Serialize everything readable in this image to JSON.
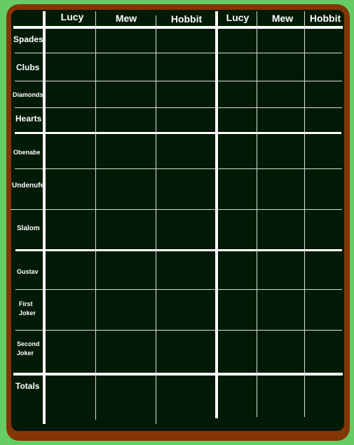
{
  "board": {
    "colors": {
      "background": "#66cc66",
      "frame": "#833604",
      "board": "#001a06",
      "chalk": "#ffffff"
    },
    "column_headers": [
      "Lucy",
      "Mew",
      "Hobbit",
      "Lucy",
      "Mew",
      "Hobbit"
    ],
    "row_labels": {
      "spades": "Spades",
      "clubs": "Clubs",
      "diamonds": "Diamonds",
      "hearts": "Hearts",
      "obenabe": "Obenabe",
      "undenufe": "Undenufe",
      "slalom": "Slalom",
      "gustav": "Gustav",
      "first_joker_1": "First",
      "first_joker_2": "Joker",
      "second_joker_1": "Second",
      "second_joker_2": "Joker",
      "totals": "Totals"
    }
  }
}
